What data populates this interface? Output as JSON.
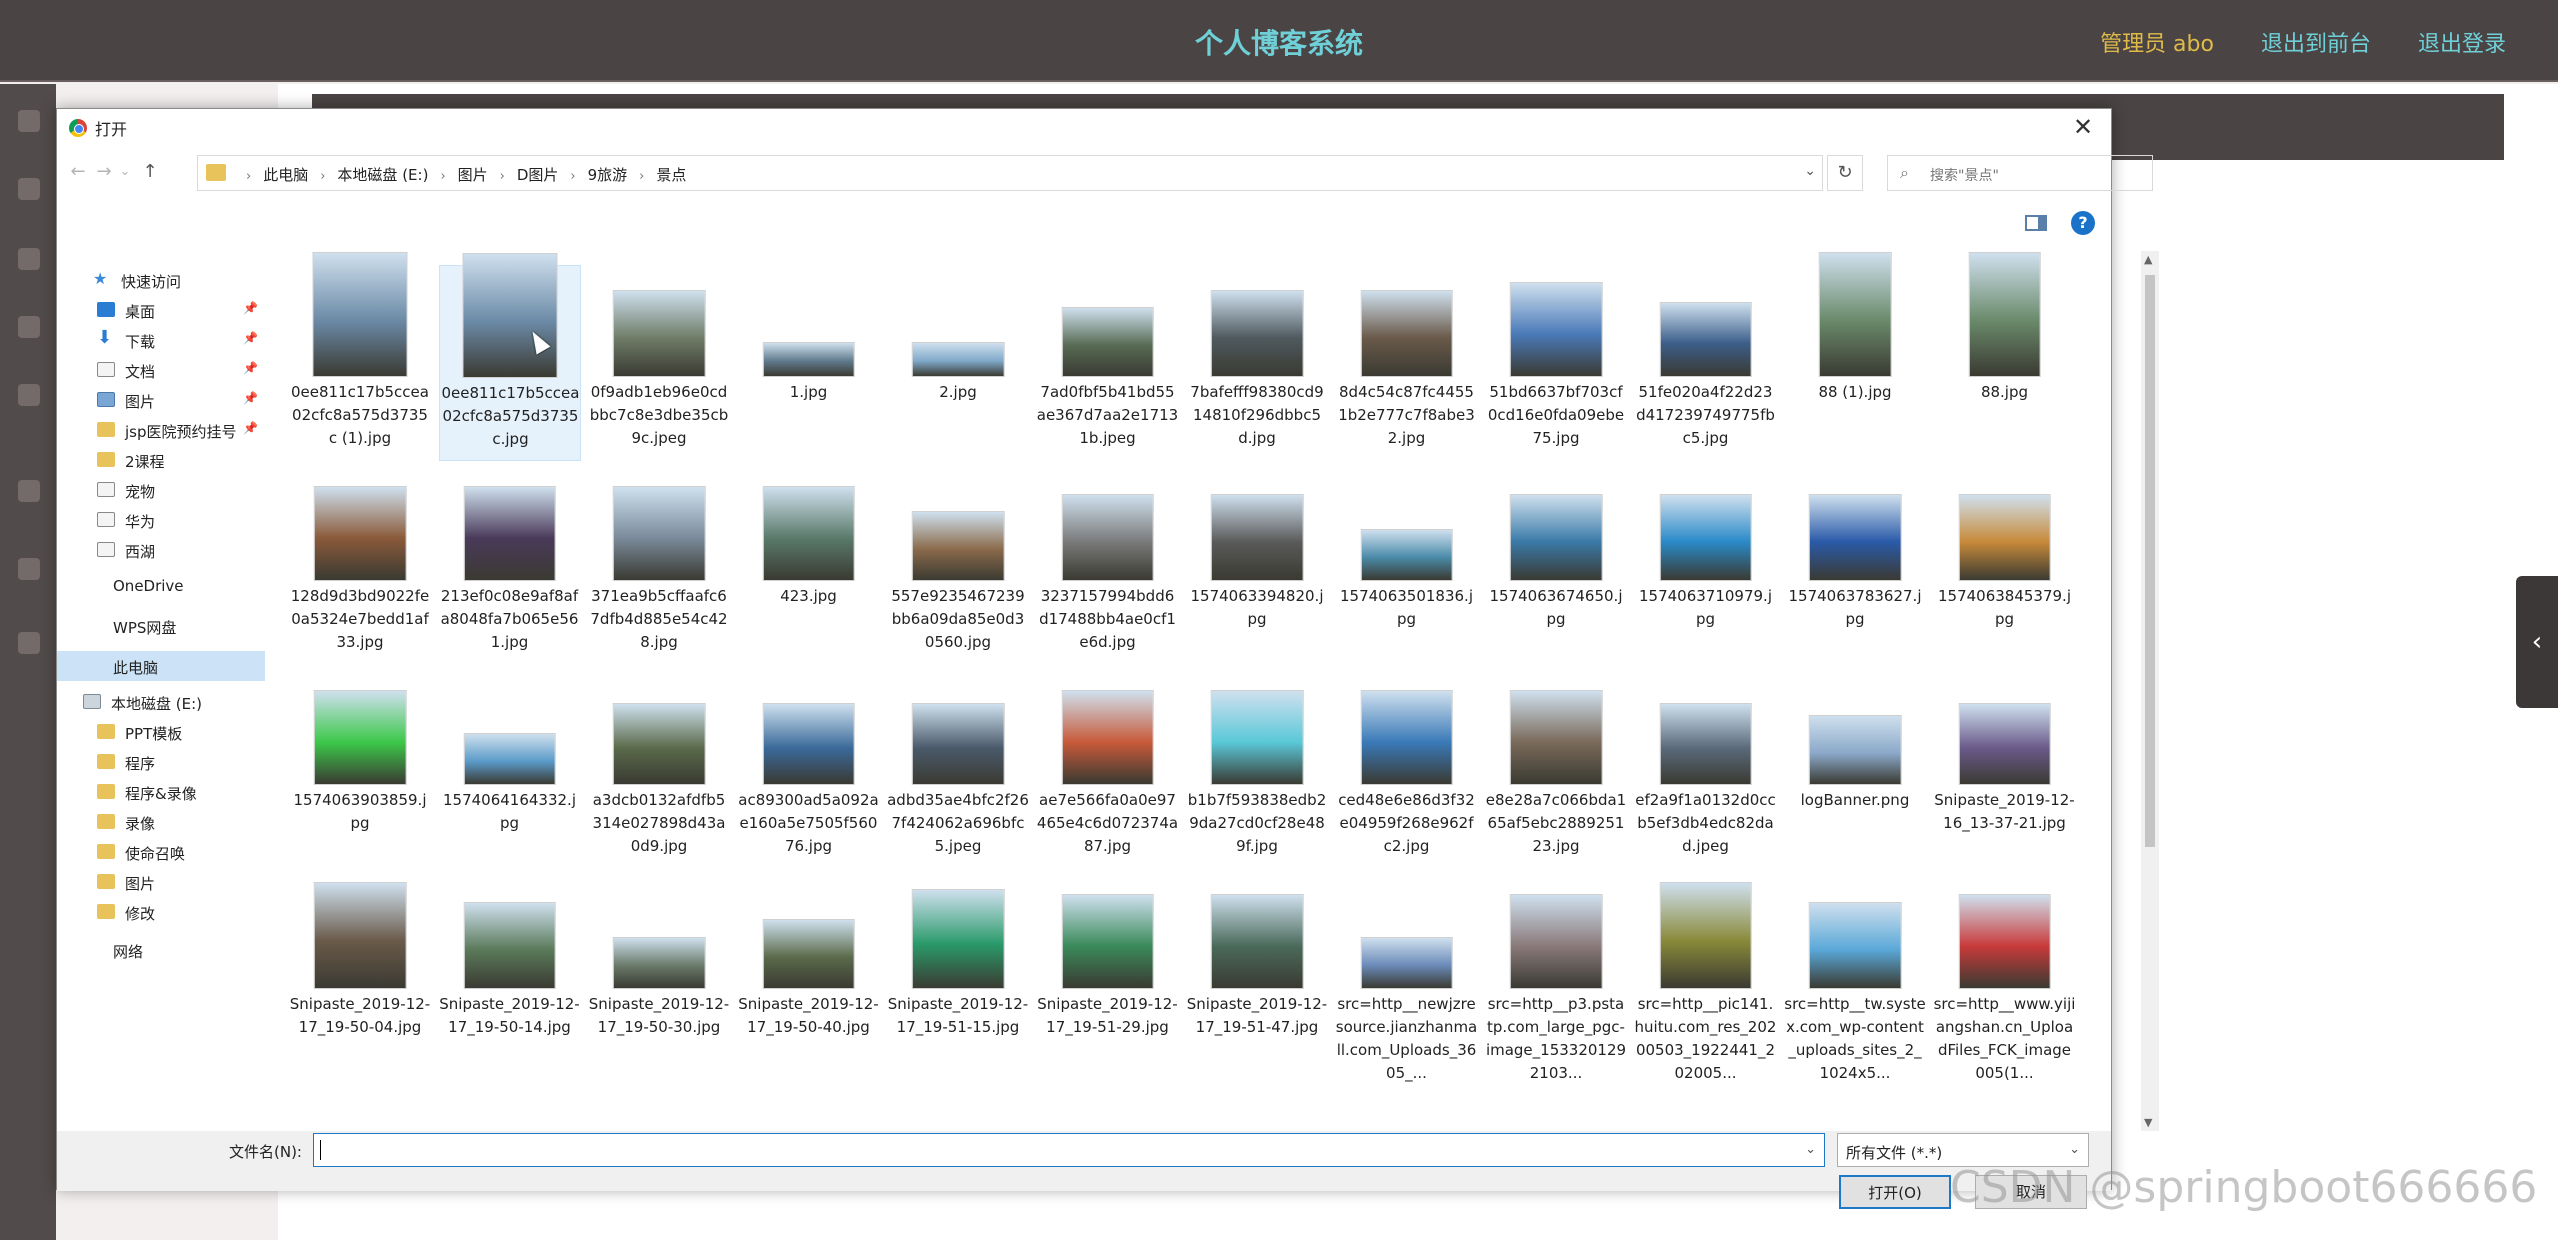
{
  "app": {
    "title": "个人博客系统",
    "admin": "管理员 abo",
    "link_front": "退出到前台",
    "link_logout": "退出登录",
    "side_tab_arrow": "‹"
  },
  "dialog": {
    "title": "打开",
    "close": "✕",
    "nav": {
      "back": "←",
      "forward": "→",
      "recent": "⌄",
      "up": "↑"
    },
    "breadcrumb": [
      "此电脑",
      "本地磁盘 (E:)",
      "图片",
      "D图片",
      "9旅游",
      "景点"
    ],
    "refresh": "↻",
    "search_placeholder": "搜索\"景点\"",
    "help": "?"
  },
  "navpane": [
    {
      "label": "快速访问",
      "icon": "star-icon"
    },
    {
      "label": "桌面",
      "icon": "desktop-icon",
      "pinned": true
    },
    {
      "label": "下载",
      "icon": "download-icon",
      "pinned": true
    },
    {
      "label": "文档",
      "icon": "document-icon",
      "pinned": true
    },
    {
      "label": "图片",
      "icon": "pictures-icon",
      "pinned": true
    },
    {
      "label": "jsp医院预约挂号",
      "icon": "folder-icon",
      "pinned": true
    },
    {
      "label": "2课程",
      "icon": "folder-icon"
    },
    {
      "label": "宠物",
      "icon": "file-icon"
    },
    {
      "label": "华为",
      "icon": "file-icon"
    },
    {
      "label": "西湖",
      "icon": "file-icon"
    },
    {
      "label": "OneDrive",
      "icon": "cloud-icon"
    },
    {
      "label": "WPS网盘",
      "icon": "cloud-icon"
    },
    {
      "label": "此电脑",
      "icon": "computer-icon",
      "selected": true
    },
    {
      "label": "本地磁盘 (E:)",
      "icon": "drive-icon"
    },
    {
      "label": "PPT模板",
      "icon": "folder-icon"
    },
    {
      "label": "程序",
      "icon": "folder-icon"
    },
    {
      "label": "程序&录像",
      "icon": "folder-icon"
    },
    {
      "label": "录像",
      "icon": "folder-icon"
    },
    {
      "label": "使命召唤",
      "icon": "folder-icon"
    },
    {
      "label": "图片",
      "icon": "folder-icon"
    },
    {
      "label": "修改",
      "icon": "folder-icon"
    },
    {
      "label": "网络",
      "icon": "network-icon"
    }
  ],
  "files": [
    [
      "0ee811c17b5ccea02cfc8a575d3735c (1).jpg",
      "0ee811c17b5ccea02cfc8a575d3735c.jpg",
      "0f9adb1eb96e0cdbbc7c8e3dbe35cb9c.jpeg",
      "1.jpg",
      "2.jpg",
      "7ad0fbf5b41bd55ae367d7aa2e17131b.jpeg",
      "7bafefff98380cd914810f296dbbc5d.jpg",
      "8d4c54c87fc44551b2e777c7f8abe32.jpg",
      "51bd6637bf703cf0cd16e0fda09ebe75.jpg",
      "51fe020a4f22d23d417239749775fbc5.jpg",
      "88 (1).jpg",
      "88.jpg"
    ],
    [
      "128d9d3bd9022fe0a5324e7bedd1af33.jpg",
      "213ef0c08e9af8afa8048fa7b065e561.jpg",
      "371ea9b5cffaafc67dfb4d885e54c428.jpg",
      "423.jpg",
      "557e9235467239bb6a09da85e0d30560.jpg",
      "3237157994bdd6d17488bb4ae0cf1e6d.jpg",
      "1574063394820.jpg",
      "1574063501836.jpg",
      "1574063674650.jpg",
      "1574063710979.jpg",
      "1574063783627.jpg",
      "1574063845379.jpg"
    ],
    [
      "1574063903859.jpg",
      "1574064164332.jpg",
      "a3dcb0132afdfb5314e027898d43a0d9.jpg",
      "ac89300ad5a092ae160a5e7505f56076.jpg",
      "adbd35ae4bfc2f267f424062a696bfc5.jpeg",
      "ae7e566fa0a0e97465e4c6d072374a87.jpg",
      "b1b7f593838edb29da27cd0cf28e489f.jpg",
      "ced48e6e86d3f32e04959f268e962fc2.jpg",
      "e8e28a7c066bda165af5ebc288925123.jpg",
      "ef2a9f1a0132d0ccb5ef3db4edc82dad.jpeg",
      "logBanner.png",
      "Snipaste_2019-12-16_13-37-21.jpg"
    ],
    [
      "Snipaste_2019-12-17_19-50-04.jpg",
      "Snipaste_2019-12-17_19-50-14.jpg",
      "Snipaste_2019-12-17_19-50-30.jpg",
      "Snipaste_2019-12-17_19-50-40.jpg",
      "Snipaste_2019-12-17_19-51-15.jpg",
      "Snipaste_2019-12-17_19-51-29.jpg",
      "Snipaste_2019-12-17_19-51-47.jpg",
      "src=http__newjzresource.jianzhanmall.com_Uploads_3605_...",
      "src=http__p3.pstatp.com_large_pgc-image_1533201292103...",
      "src=http__pic141.huitu.com_res_20200503_1922441_202005...",
      "src=http__tw.systex.com_wp-content_uploads_sites_2_1024x5...",
      "src=http__www.yijiangshan.cn_UploadFiles_FCK_image005(1..."
    ]
  ],
  "thumb_colors": [
    [
      "#6b8aa6",
      "#6b8aa6",
      "#6f7d68",
      "#5f7a8c",
      "#7fa8c8",
      "#586b54",
      "#4f5a5f",
      "#6a5a4a",
      "#4a7ab8",
      "#3c5f8a",
      "#6a8a6a",
      "#6a8a6a"
    ],
    [
      "#8a5a3a",
      "#4a3a5a",
      "#7a8a9a",
      "#5a7a6a",
      "#8a6a4a",
      "#7a7a7a",
      "#5a5a5a",
      "#4a8aa8",
      "#3a7aa8",
      "#2a8ac8",
      "#2a5aa8",
      "#c88a3a"
    ],
    [
      "#3cc84a",
      "#5a9ac8",
      "#5a6a4a",
      "#3a6a9a",
      "#4a5a6a",
      "#c85a3a",
      "#5ac8d8",
      "#3a7ab8",
      "#7a6a5a",
      "#5a6a7a",
      "#8aa8c8",
      "#6a5a8a"
    ],
    [
      "#6a5a4a",
      "#5a7a5a",
      "#6a7a6a",
      "#5a6a4a",
      "#2a9a6a",
      "#3a8a5a",
      "#4a6a5a",
      "#6a8ab8",
      "#8a7a7a",
      "#8a8a3a",
      "#5aa8d8",
      "#c83a3a"
    ]
  ],
  "selected_file_index": 1,
  "filename_label": "文件名(N):",
  "filename_value": "",
  "filetype": "所有文件 (*.*)",
  "open_button": "打开(O)",
  "cancel_button": "取消",
  "watermark": "CSDN @springboot666666"
}
